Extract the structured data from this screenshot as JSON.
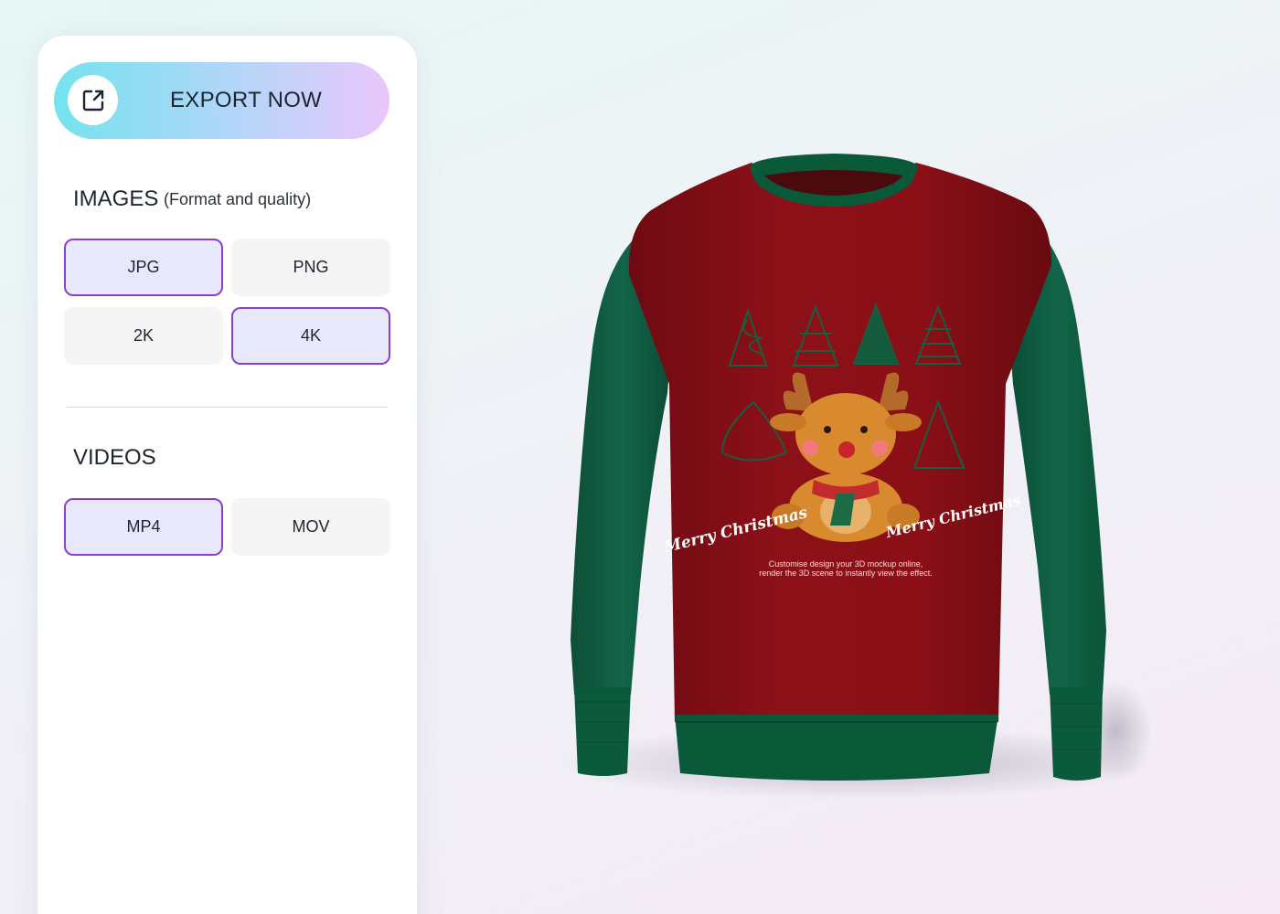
{
  "export": {
    "label": "EXPORT NOW",
    "icon": "external-link-icon"
  },
  "images": {
    "title": "IMAGES",
    "subtitle": "(Format and quality)",
    "formats": [
      {
        "label": "JPG",
        "selected": true
      },
      {
        "label": "PNG",
        "selected": false
      }
    ],
    "qualities": [
      {
        "label": "2K",
        "selected": false
      },
      {
        "label": "4K",
        "selected": true
      }
    ]
  },
  "videos": {
    "title": "VIDEOS",
    "formats": [
      {
        "label": "MP4",
        "selected": true
      },
      {
        "label": "MOV",
        "selected": false
      }
    ]
  },
  "mockup": {
    "left_text": "Merry Christmas",
    "right_text": "Merry Christmas",
    "caption_line1": "Customise design your 3D mockup online,",
    "caption_line2": "render the 3D scene to instantly view the effect.",
    "colors": {
      "body": "#8a0f17",
      "sleeves": "#0f5a3e",
      "trim": "#0a5a3a",
      "reindeer": "#d98a2e"
    }
  },
  "colors": {
    "accent": "#8b3fd0",
    "selected_bg": "#e8e8fd",
    "option_bg": "#f5f5f5"
  }
}
